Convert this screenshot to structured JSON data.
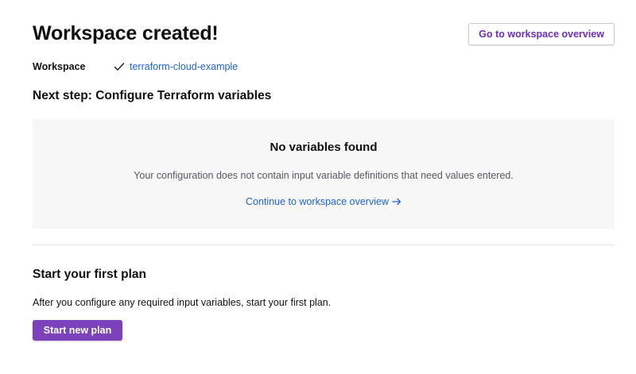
{
  "header": {
    "title": "Workspace created!",
    "overview_button_label": "Go to workspace overview"
  },
  "workspace": {
    "label": "Workspace",
    "status_icon": "check-icon",
    "name": "terraform-cloud-example"
  },
  "next_step": {
    "heading": "Next step: Configure Terraform variables"
  },
  "variables_panel": {
    "title": "No variables found",
    "description": "Your configuration does not contain input variable definitions that need values entered.",
    "link_label": "Continue to workspace overview",
    "link_icon": "arrow-right-icon"
  },
  "first_plan": {
    "heading": "Start your first plan",
    "description": "After you configure any required input variables, start your first plan.",
    "button_label": "Start new plan"
  },
  "colors": {
    "accent_purple": "#7b42bc",
    "link_blue": "#1f63d6",
    "panel_background": "#f7f7f8"
  }
}
